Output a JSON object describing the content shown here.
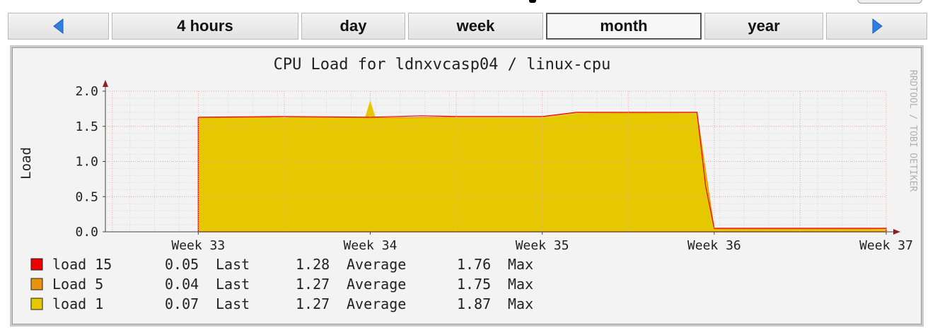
{
  "nav": {
    "prev_icon": "triangle-left-icon",
    "next_icon": "triangle-right-icon",
    "buttons": [
      "4 hours",
      "day",
      "week",
      "month",
      "year"
    ],
    "active": "month",
    "accent_color": "#2f7fe0"
  },
  "chart_data": {
    "type": "area",
    "title": "CPU Load for ldnxvcasp04 / linux-cpu",
    "ylabel": "Load",
    "watermark": "RRDTOOL / TOBI OETIKER",
    "ylim": [
      0,
      2.0
    ],
    "y_ticks": [
      "0.0",
      "0.5",
      "1.0",
      "1.5",
      "2.0"
    ],
    "x_ticks": [
      "Week 33",
      "Week 34",
      "Week 35",
      "Week 36",
      "Week 37"
    ],
    "series": [
      {
        "name": "load 15",
        "color": "#ee0000",
        "last": "0.05",
        "average": "1.28",
        "max": "1.76",
        "points": [
          [
            33.0,
            1.63
          ],
          [
            33.5,
            1.64
          ],
          [
            34.0,
            1.63
          ],
          [
            34.3,
            1.65
          ],
          [
            34.5,
            1.64
          ],
          [
            35.0,
            1.64
          ],
          [
            35.2,
            1.7
          ],
          [
            35.5,
            1.7
          ],
          [
            35.9,
            1.7
          ],
          [
            35.95,
            0.65
          ],
          [
            36.0,
            0.05
          ],
          [
            36.5,
            0.05
          ],
          [
            37.0,
            0.05
          ]
        ]
      },
      {
        "name": "Load 5",
        "color": "#e8920e",
        "last": "0.04",
        "average": "1.27",
        "max": "1.75",
        "points": [
          [
            33.0,
            1.62
          ],
          [
            33.5,
            1.63
          ],
          [
            34.0,
            1.62
          ],
          [
            34.5,
            1.63
          ],
          [
            35.0,
            1.63
          ],
          [
            35.2,
            1.69
          ],
          [
            35.5,
            1.69
          ],
          [
            35.9,
            1.69
          ],
          [
            36.0,
            0.04
          ],
          [
            36.5,
            0.04
          ],
          [
            37.0,
            0.04
          ]
        ]
      },
      {
        "name": "load 1",
        "color": "#e6c800",
        "last": "0.07",
        "average": "1.27",
        "max": "1.87",
        "points": [
          [
            33.0,
            1.62
          ],
          [
            33.5,
            1.62
          ],
          [
            33.97,
            1.63
          ],
          [
            34.0,
            1.87
          ],
          [
            34.03,
            1.63
          ],
          [
            34.5,
            1.62
          ],
          [
            35.0,
            1.62
          ],
          [
            35.2,
            1.68
          ],
          [
            35.5,
            1.69
          ],
          [
            35.9,
            1.68
          ],
          [
            36.0,
            0.04
          ],
          [
            36.5,
            0.05
          ],
          [
            37.0,
            0.03
          ]
        ]
      }
    ],
    "legend_words": {
      "last": "Last",
      "average": "Average",
      "max": "Max"
    },
    "grid": true
  }
}
